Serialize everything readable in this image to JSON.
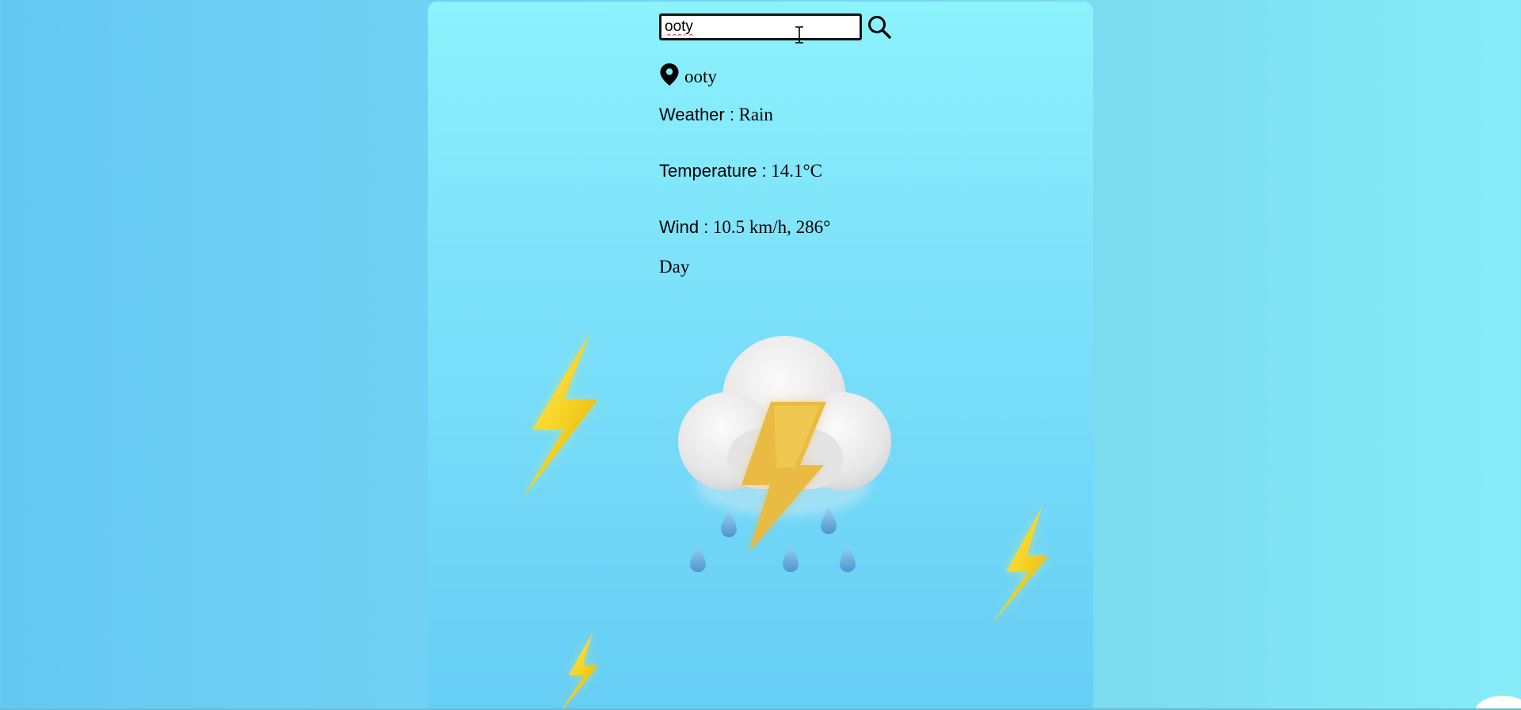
{
  "search": {
    "value": "ooty",
    "placeholder": ""
  },
  "icons": {
    "search": "search-icon",
    "location": "location-pin-icon",
    "weather": "thunderstorm-cloud-icon",
    "decor": "lightning-bolt-icon"
  },
  "location": {
    "name": "ooty"
  },
  "weather": {
    "label": "Weather :",
    "value": "Rain"
  },
  "temperature": {
    "label": "Temperature :",
    "value": "14.1°C"
  },
  "wind": {
    "label": "Wind :",
    "value": "10.5 km/h, 286°"
  },
  "daytime": {
    "value": "Day"
  },
  "colors": {
    "card_top": "#8cf2fc",
    "card_bottom": "#66cdf5",
    "bolt": "#f3d52a",
    "cloud": "#ececec",
    "drop": "#5aa6d8"
  }
}
